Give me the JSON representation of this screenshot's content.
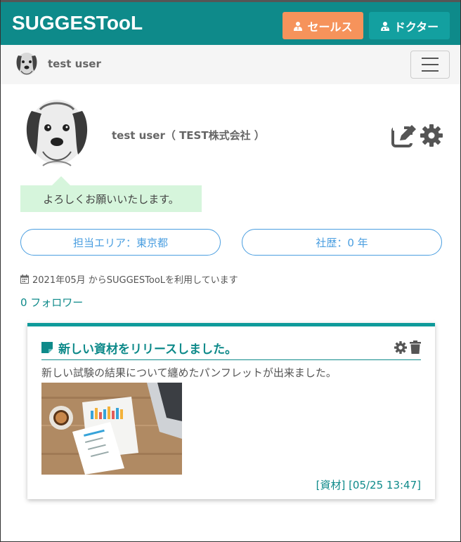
{
  "header": {
    "logo": "SUGGESTooL",
    "sales_label": "セールス",
    "doctor_label": "ドクター"
  },
  "userbar": {
    "username": "test user"
  },
  "profile": {
    "name_company": "test user（ TEST株式会社 ）",
    "greeting": "よろしくお願いいたします。",
    "area": "担当エリア：東京都",
    "years": "社歴：0 年",
    "since": "2021年05月 からSUGGESTooLを利用しています",
    "followers": "0 フォロワー"
  },
  "post": {
    "title": "新しい資材をリリースしました。",
    "body": "新しい試験の結果について纏めたパンフレットが出来ました。",
    "meta": "[資材] [05/25 13:47]"
  },
  "colors": {
    "brand": "#0e8a8a",
    "sales": "#f6935b",
    "doctor": "#13a0a0",
    "pill": "#4a9ee0",
    "bubble": "#d6f5dc"
  }
}
